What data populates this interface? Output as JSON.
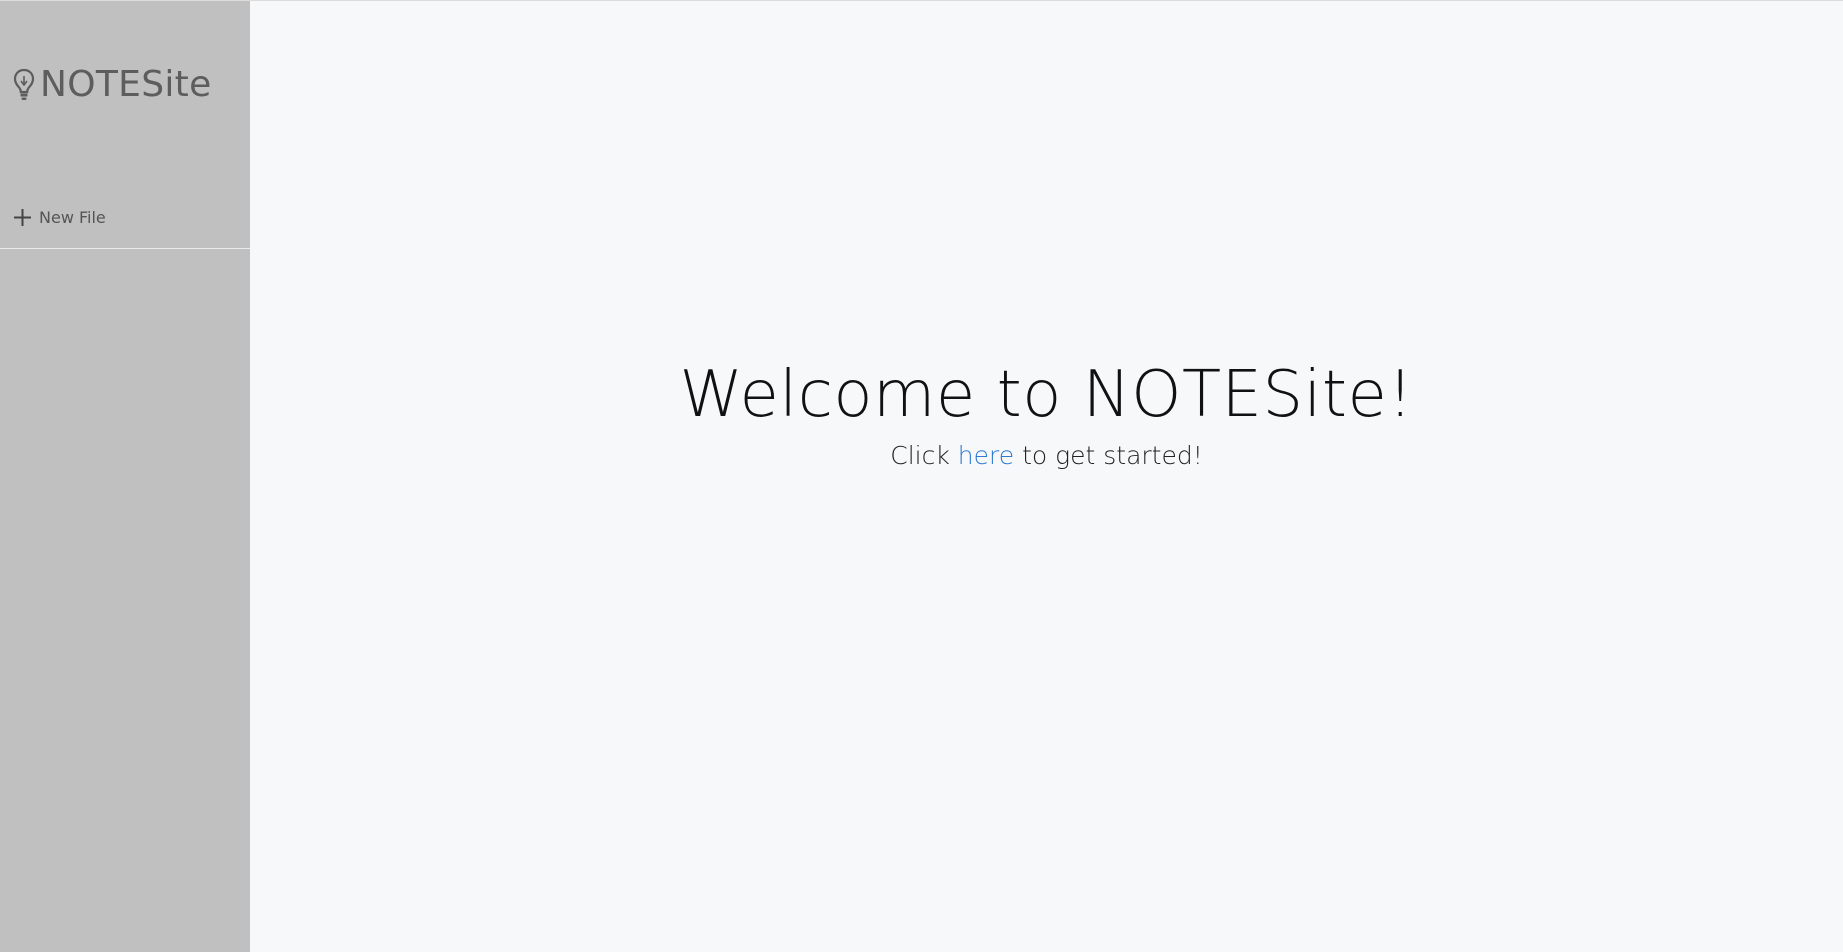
{
  "app": {
    "brand": "NOTESite",
    "brand_icon": "lightbulb-icon",
    "accent_color": "#2f7bd1"
  },
  "sidebar": {
    "new_file_label": "New File",
    "new_file_icon": "plus-icon"
  },
  "main": {
    "welcome_title": "Welcome to NOTESite!",
    "subtitle_prefix": "Click ",
    "subtitle_link": "here",
    "subtitle_suffix": " to get started!"
  }
}
